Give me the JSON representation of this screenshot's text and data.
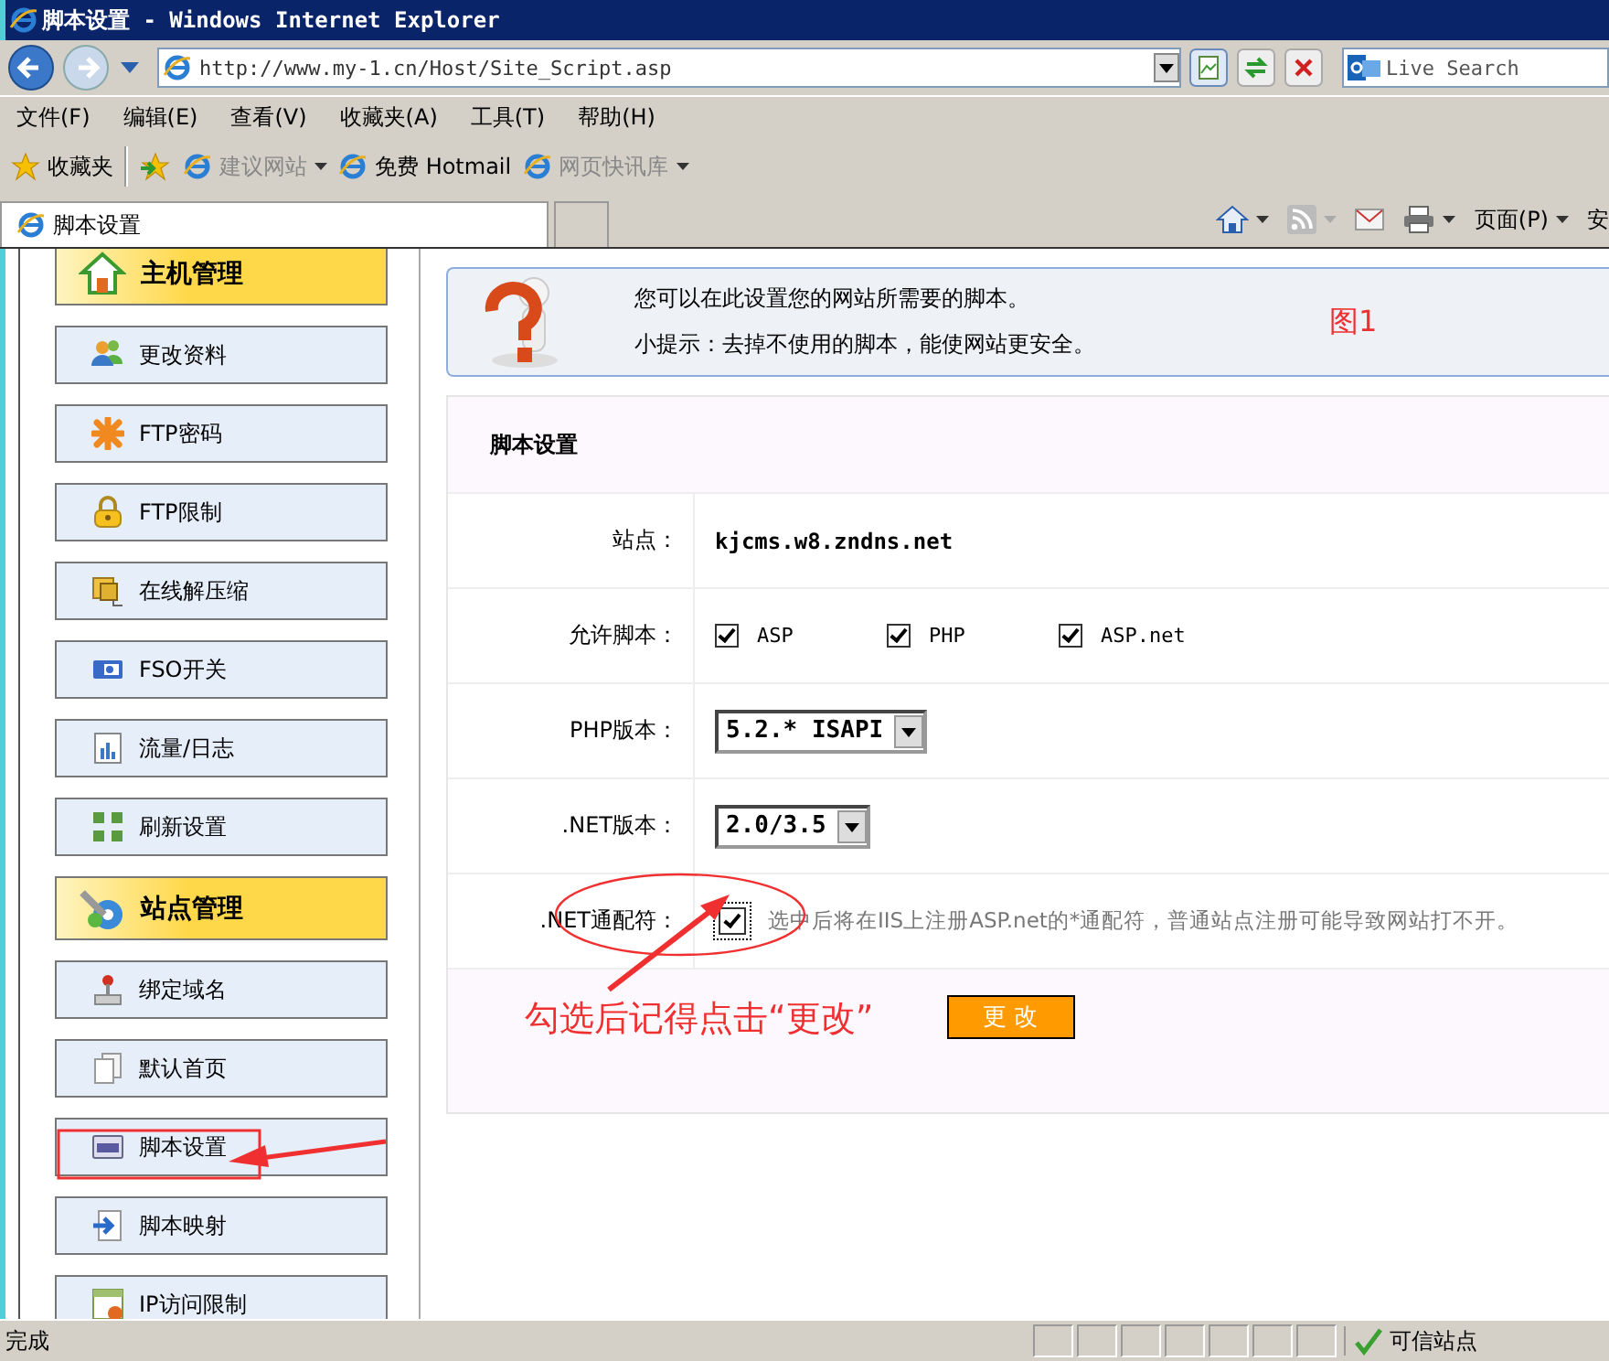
{
  "window": {
    "title": "脚本设置 - Windows Internet Explorer"
  },
  "address_bar": {
    "value": "http://www.my-1.cn/Host/Site_Script.asp"
  },
  "search": {
    "placeholder": "Live Search"
  },
  "menu": [
    "文件(F)",
    "编辑(E)",
    "查看(V)",
    "收藏夹(A)",
    "工具(T)",
    "帮助(H)"
  ],
  "favorites_bar": {
    "label": "收藏夹",
    "links": [
      {
        "label": "建议网站",
        "dropdown": true,
        "disabled": true
      },
      {
        "label": "免费 Hotmail",
        "dropdown": false,
        "disabled": false
      },
      {
        "label": "网页快讯库",
        "dropdown": true,
        "disabled": true
      }
    ]
  },
  "tabs": [
    {
      "label": "脚本设置",
      "selected": true
    }
  ],
  "command_bar": {
    "page_menu": "页面(P)",
    "safety_menu": "安"
  },
  "sidebar": {
    "groups": [
      {
        "title": "主机管理",
        "items": [
          "更改资料",
          "FTP密码",
          "FTP限制",
          "在线解压缩",
          "FSO开关",
          "流量/日志",
          "刷新设置"
        ]
      },
      {
        "title": "站点管理",
        "items": [
          "绑定域名",
          "默认首页",
          "脚本设置",
          "脚本映射",
          "IP访问限制"
        ]
      }
    ]
  },
  "notice": {
    "lines": [
      "您可以在此设置您的网站所需要的脚本。",
      "小提示：去掉不使用的脚本，能使网站更安全。"
    ],
    "figure_label": "图1"
  },
  "form": {
    "title": "脚本设置",
    "rows": [
      {
        "kind": "text",
        "label": "站点：",
        "value": "kjcms.w8.zndns.net"
      },
      {
        "kind": "checkboxes",
        "label": "允许脚本：",
        "options": [
          {
            "label": "ASP",
            "checked": true
          },
          {
            "label": "PHP",
            "checked": true
          },
          {
            "label": "ASP.net",
            "checked": true
          }
        ]
      },
      {
        "kind": "select",
        "label": "PHP版本：",
        "value": "5.2.* ISAPI"
      },
      {
        "kind": "select",
        "label": ".NET版本：",
        "value": "2.0/3.5"
      },
      {
        "kind": "checkbox",
        "label": ".NET通配符：",
        "checked": true,
        "hint": "选中后将在IIS上注册ASP.net的*通配符，普通站点注册可能导致网站打不开。"
      }
    ],
    "submit": "更 改"
  },
  "annotation": {
    "callout": "勾选后记得点击“更改”"
  },
  "status_bar": {
    "text": "完成",
    "zone": "可信站点"
  }
}
